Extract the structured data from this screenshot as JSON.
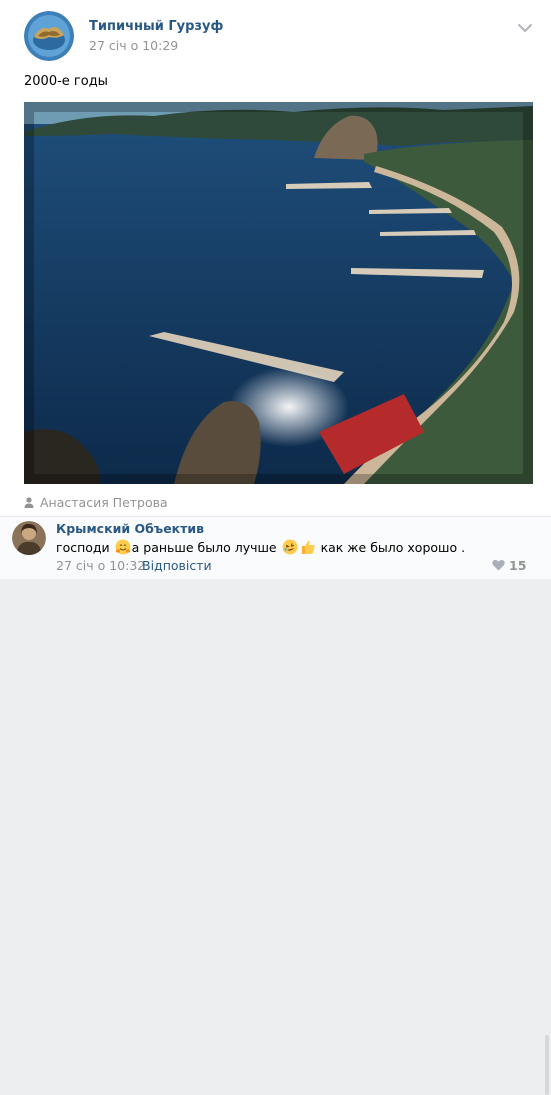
{
  "post": {
    "author": "Типичный Гурзуф",
    "date": "27 січ о 10:29",
    "text": "2000-е годы",
    "source": "Анастасия Петрова",
    "photo_icon": "photo-coastline"
  },
  "comment": {
    "author": "Крымский Объектив",
    "text_part1": "господи ",
    "text_part2": "а раньше было лучше ",
    "text_part3": " как же было хорошо .",
    "date": "27 січ о 10:32",
    "reply_label": "Відповісти",
    "likes": "15",
    "emoji_icons": [
      "hugging-face",
      "rolling-laughing",
      "thumbs-up"
    ]
  },
  "colors": {
    "link": "#2a5885",
    "muted": "#939393"
  }
}
